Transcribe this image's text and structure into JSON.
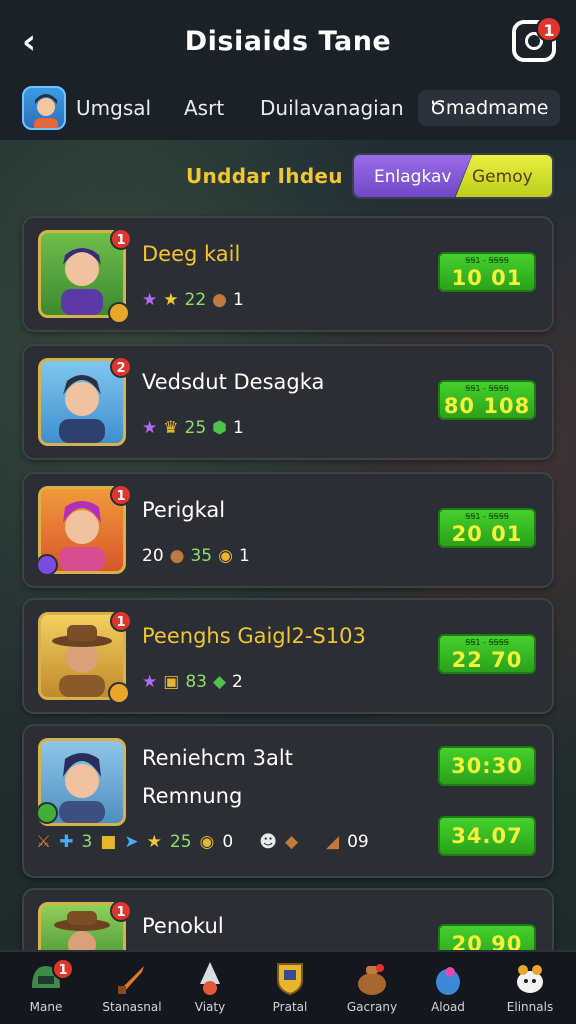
{
  "header": {
    "title": "Disiaids Tane",
    "notification_count": "1"
  },
  "tabs": {
    "items": [
      {
        "label": "Umgsal"
      },
      {
        "label": "Asrt"
      },
      {
        "label": "Duilavanagian"
      },
      {
        "label": "Ծmadmame"
      }
    ]
  },
  "filter": {
    "subtitle": "Unddar Ihdeu",
    "toggle_left": "Enlagkav",
    "toggle_right": "Gemoy"
  },
  "players": [
    {
      "name": "Deeg kail",
      "badge": "1",
      "stats": [
        "22",
        "1"
      ],
      "time_caption": "ꞨꞨ1 - ꞨꞨꞨꞨ",
      "time": "10 01"
    },
    {
      "name": "Vedsdut Desagka",
      "badge": "2",
      "stats": [
        "25",
        "1"
      ],
      "time_caption": "ꞨꞨ1 - ꞨꞨꞨꞨ",
      "time": "80 108"
    },
    {
      "name": "Perigkal",
      "badge": "1",
      "stats": [
        "20",
        "35",
        "1"
      ],
      "time_caption": "ꞨꞨ1 - ꞨꞨꞨꞨ",
      "time": "20 01"
    },
    {
      "name": "Peenghs Gaigl2-S103",
      "badge": "1",
      "stats": [
        "83",
        "2"
      ],
      "time_caption": "ꞨꞨ1 - ꞨꞨꞨꞨ",
      "time": "22 70"
    },
    {
      "name": "Reniehcm 3alt",
      "subtext": "Remnung",
      "stats": [
        "3",
        "25",
        "0",
        "09"
      ],
      "time": "30:30",
      "time2": "34.07"
    },
    {
      "name": "Penokul",
      "badge": "1",
      "time": "20 90"
    }
  ],
  "nav": {
    "items": [
      {
        "label": "Mane",
        "badge": "1"
      },
      {
        "label": "Stanasnal"
      },
      {
        "label": "Viaty"
      },
      {
        "label": "Pratal"
      },
      {
        "label": "Gacrany"
      },
      {
        "label": "Aload"
      },
      {
        "label": "Elinnals"
      }
    ]
  },
  "colors": {
    "accent_gold": "#f2c631",
    "timer_green": "#3cc127",
    "badge_red": "#e0352b"
  }
}
